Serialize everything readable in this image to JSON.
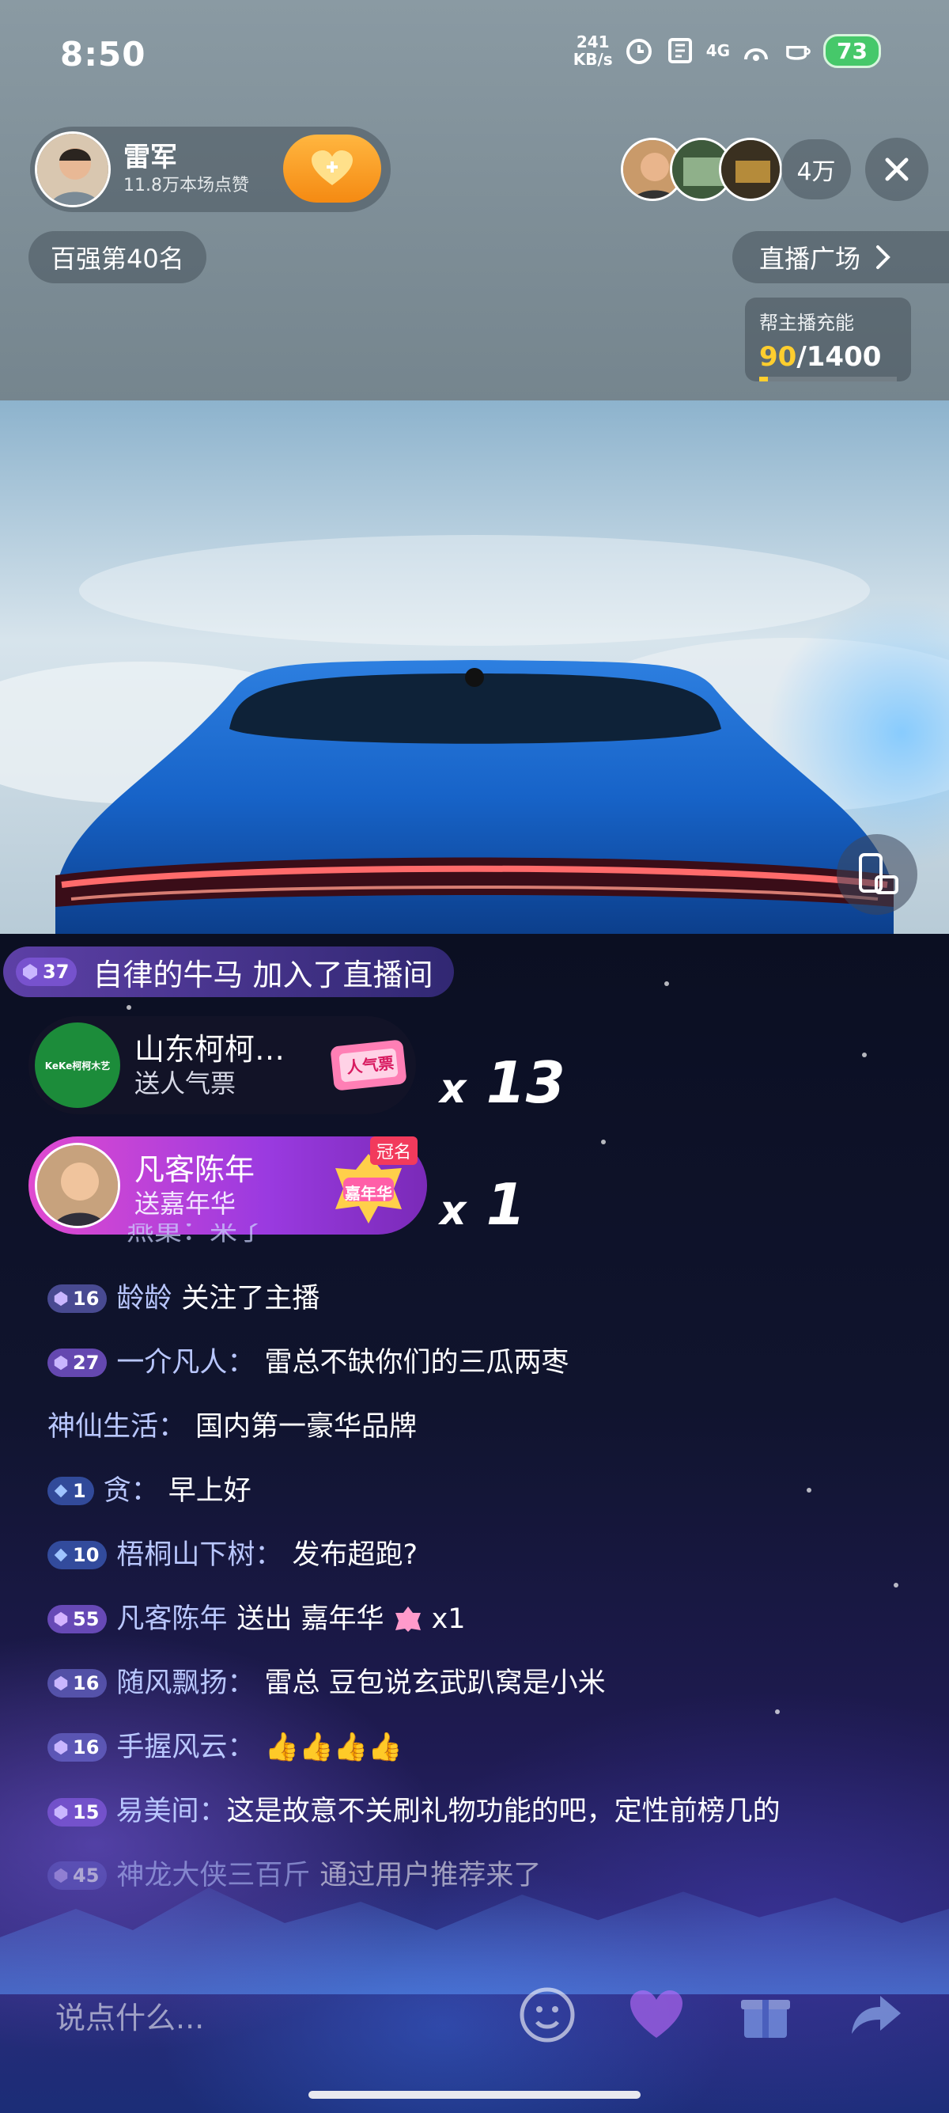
{
  "status_bar": {
    "time": "8:50",
    "net_speed_value": "241",
    "net_speed_unit": "KB/s",
    "network": "4G",
    "battery": "73"
  },
  "host": {
    "name": "雷军",
    "likes": "11.8万本场点赞"
  },
  "viewer_count": "4万",
  "rank": "百强第40名",
  "live_square": "直播广场",
  "charge": {
    "label": "帮主播充能",
    "current": "90",
    "separator": "/",
    "target": "1400",
    "progress_fraction": 0.064
  },
  "join_banner": {
    "level": "37",
    "text": "自律的牛马 加入了直播间"
  },
  "gifts": [
    {
      "name": "山东柯柯…",
      "action": "送人气票",
      "gift_label": "人气票",
      "count_x": "x",
      "count": "13",
      "avatar_text": "KeKe柯柯木艺"
    },
    {
      "name": "凡客陈年",
      "action": "送嘉年华",
      "gift_label": "嘉年华",
      "tag": "冠名",
      "count_x": "x",
      "count": "1"
    }
  ],
  "partial_line": "燕巢：来了",
  "chat": [
    {
      "level": "16",
      "user": "龄龄",
      "sep": "",
      "text": "关注了主播"
    },
    {
      "level": "27",
      "user": "一介凡人",
      "sep": "：",
      "text": "雷总不缺你们的三瓜两枣"
    },
    {
      "level": "",
      "user": "神仙生活",
      "sep": "：",
      "text": "国内第一豪华品牌"
    },
    {
      "level": "1",
      "user": "贪",
      "sep": "：",
      "text": "早上好"
    },
    {
      "level": "10",
      "user": "梧桐山下树",
      "sep": "：",
      "text": "发布超跑?"
    },
    {
      "level": "55",
      "user": "凡客陈年",
      "sep": "",
      "text": "送出 嘉年华",
      "suffix": "x1"
    },
    {
      "level": "16",
      "user": "随风飘扬",
      "sep": "：",
      "text": "雷总  豆包说玄武趴窝是小米"
    },
    {
      "level": "16",
      "user": "手握风云",
      "sep": "：",
      "text": "👍👍👍👍"
    },
    {
      "level": "15",
      "user": "易美间",
      "sep": "：",
      "text": "这是故意不关刷礼物功能的吧，定性前榜几的"
    },
    {
      "level": "45",
      "user": "神龙大侠三百斤",
      "sep": "",
      "text": "通过用户推荐来了"
    }
  ],
  "input_placeholder": "说点什么...",
  "colors": {
    "accent_orange": "#f58a12",
    "charge_yellow": "#ffce2e",
    "battery_green": "#46c86a",
    "username_blue": "#b9c7ff"
  }
}
